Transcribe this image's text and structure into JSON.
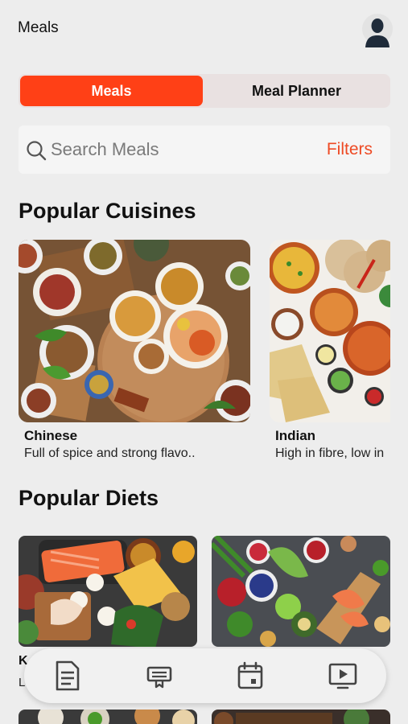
{
  "header": {
    "title": "Meals",
    "avatar_icon": "user-avatar-icon"
  },
  "tabs": [
    {
      "label": "Meals",
      "active": true
    },
    {
      "label": "Meal Planner",
      "active": false
    }
  ],
  "search": {
    "placeholder": "Search Meals",
    "value": "",
    "filters_label": "Filters"
  },
  "sections": {
    "cuisines_title": "Popular Cuisines",
    "diets_title": "Popular Diets"
  },
  "cuisines": [
    {
      "name": "Chinese",
      "description": "Full of spice and strong flavo.."
    },
    {
      "name": "Indian",
      "description": "High in fibre, low in"
    }
  ],
  "diets": [
    {
      "name": "K",
      "description": "L"
    },
    {
      "name": "",
      "description": ""
    }
  ],
  "bottom_nav": [
    {
      "icon": "document-icon"
    },
    {
      "icon": "recipe-book-icon"
    },
    {
      "icon": "calendar-icon"
    },
    {
      "icon": "video-play-icon"
    }
  ],
  "colors": {
    "accent": "#ff4016",
    "filters": "#ee4a24",
    "background": "#ededed"
  }
}
